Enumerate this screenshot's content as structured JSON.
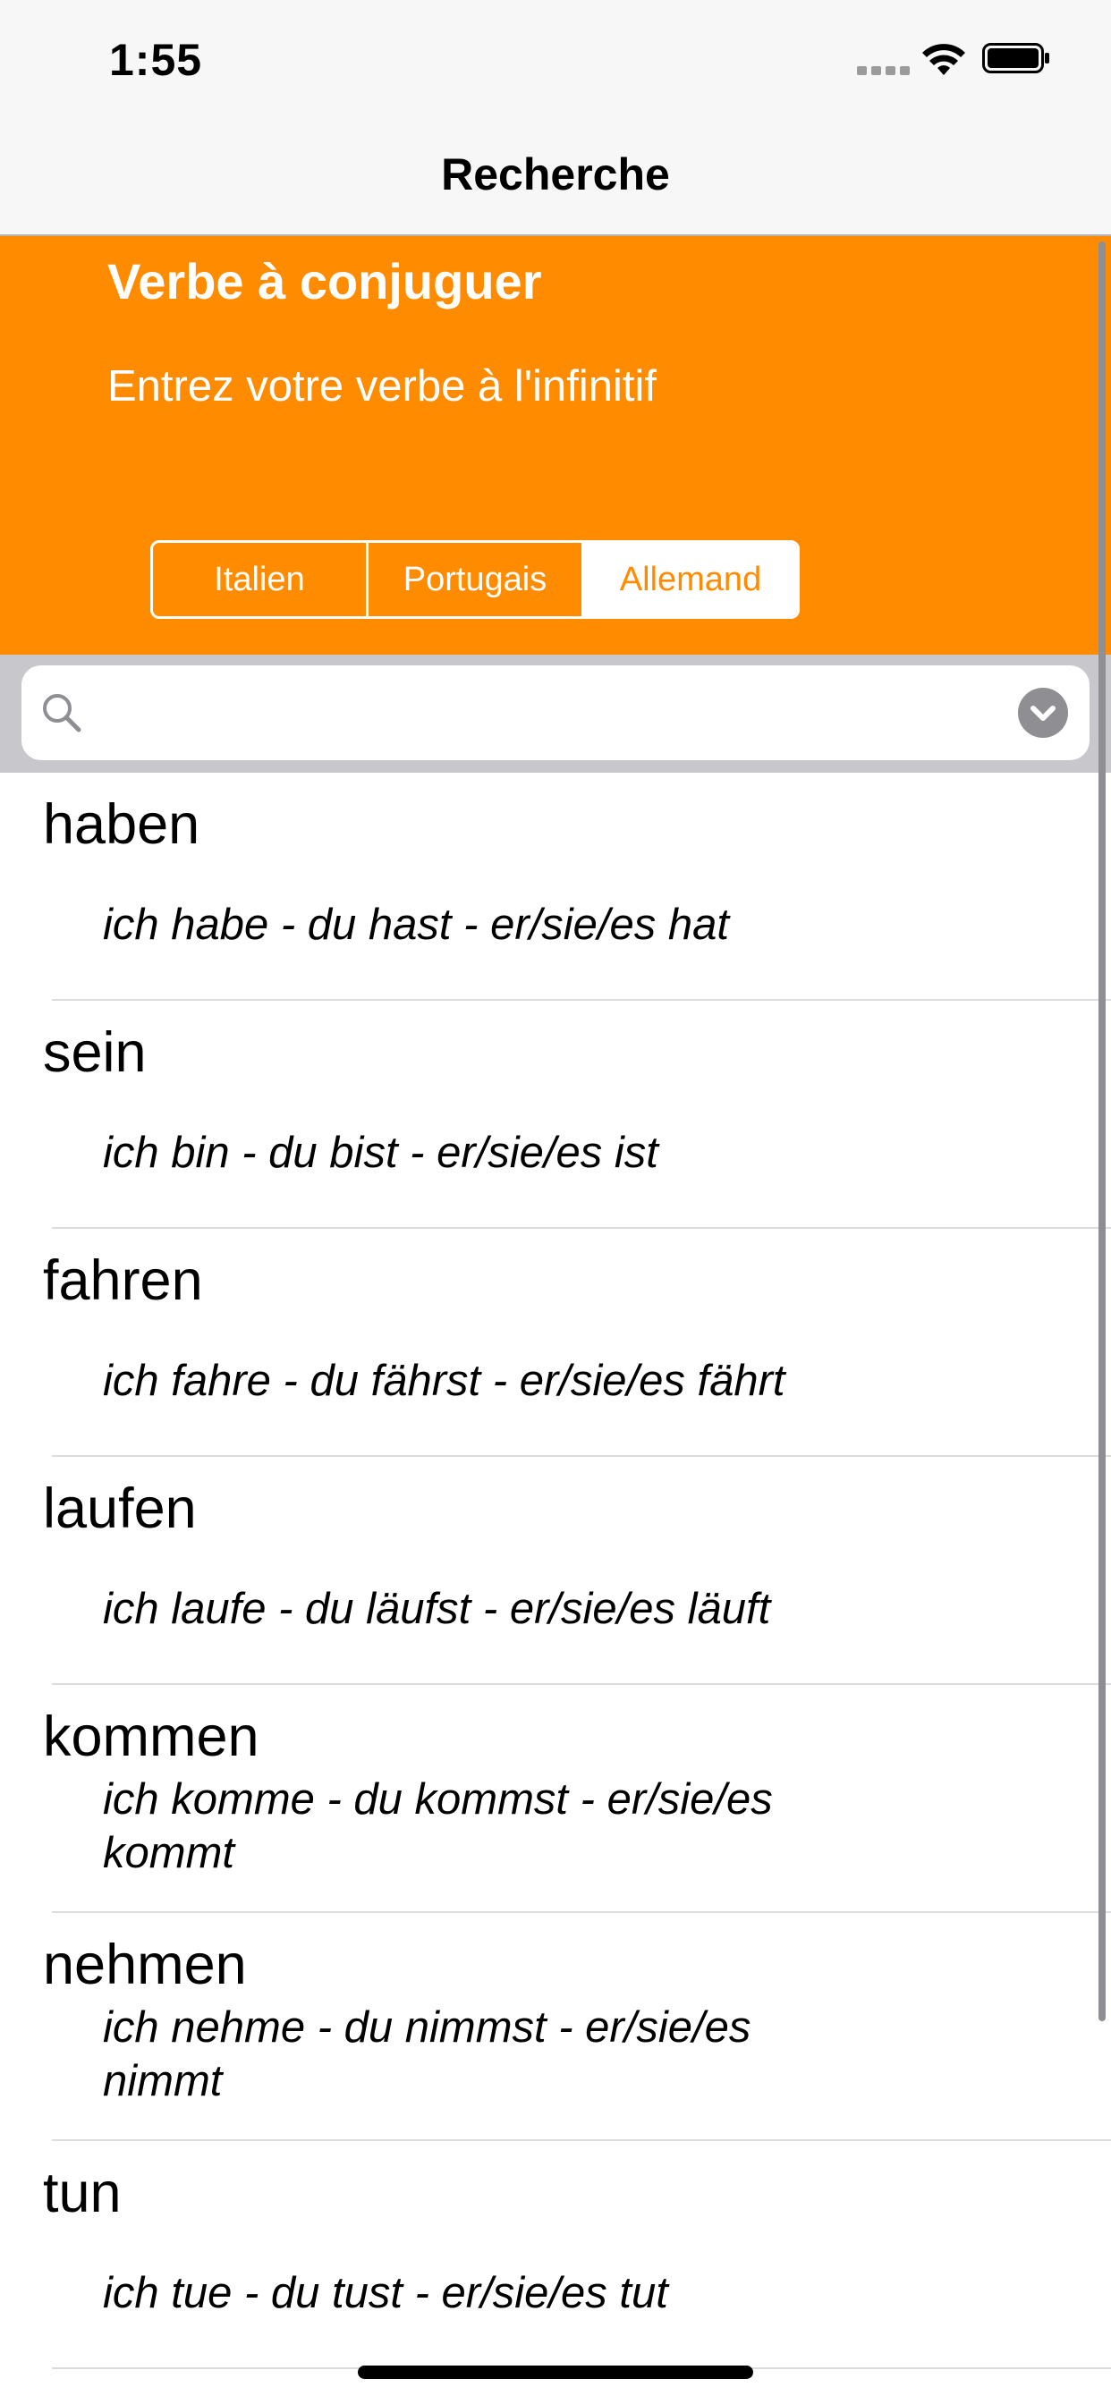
{
  "status_bar": {
    "time": "1:55",
    "icons": [
      "signal-icon",
      "wifi-icon",
      "battery-icon"
    ]
  },
  "nav": {
    "title": "Recherche"
  },
  "header": {
    "title": "Verbe à conjuguer",
    "subtitle": "Entrez votre verbe à l'infinitif"
  },
  "languages": {
    "options": [
      "Italien",
      "Portugais",
      "Allemand"
    ],
    "selected": "Allemand"
  },
  "search": {
    "value": "",
    "icon": "search-icon",
    "dropdown_icon": "chevron-down-icon"
  },
  "verbs": [
    {
      "verb": "haben",
      "conjugation": "ich habe - du hast - er/sie/es hat"
    },
    {
      "verb": "sein",
      "conjugation": "ich bin - du bist - er/sie/es ist"
    },
    {
      "verb": "fahren",
      "conjugation": "ich fahre - du fährst - er/sie/es fährt"
    },
    {
      "verb": "laufen",
      "conjugation": "ich laufe - du läufst - er/sie/es läuft"
    },
    {
      "verb": "kommen",
      "conjugation": "ich komme - du kommst - er/sie/es kommt"
    },
    {
      "verb": "nehmen",
      "conjugation": "ich nehme - du nimmst - er/sie/es nimmt"
    },
    {
      "verb": "tun",
      "conjugation": "ich tue - du tust - er/sie/es tut"
    }
  ],
  "colors": {
    "accent": "#ff8c00",
    "nav_background": "#f7f7f7",
    "search_bar_background": "#c8c7cc"
  }
}
